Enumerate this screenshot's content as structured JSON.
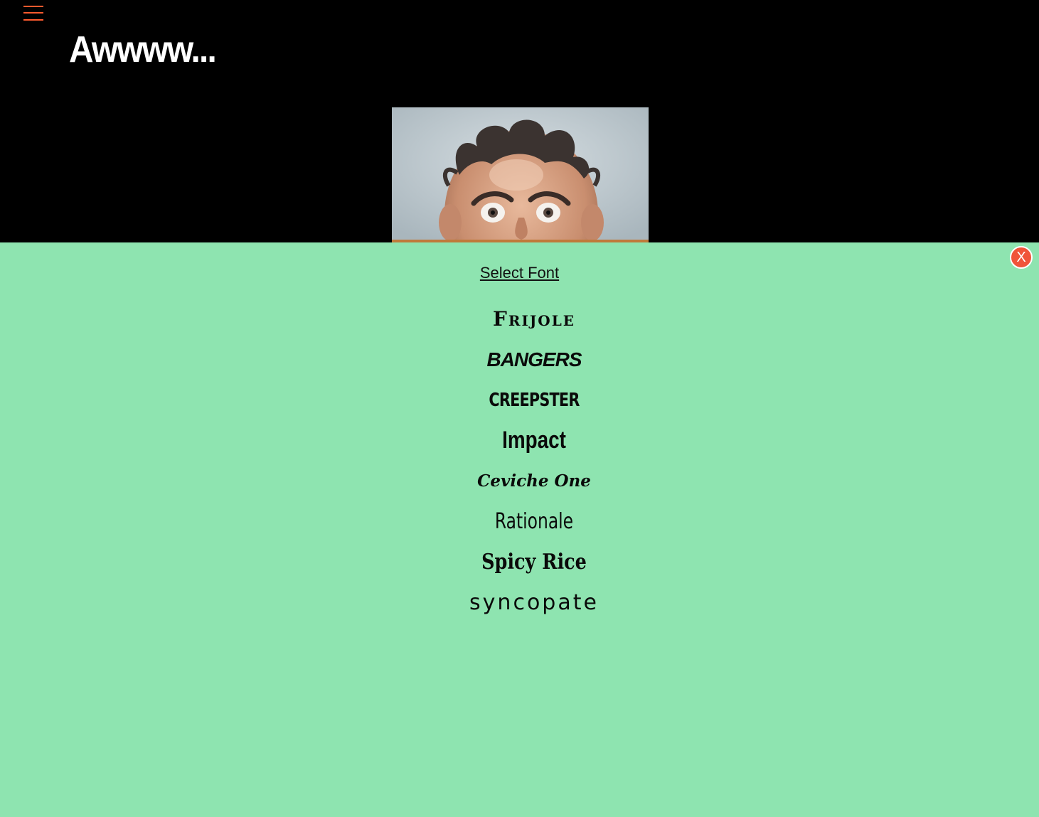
{
  "header": {
    "menu_icon": "hamburger-menu-icon",
    "accent_color": "#ff5a2e",
    "meme_title": "Awwww..."
  },
  "meme": {
    "image_subject": "bald-man-wide-eyes-photo"
  },
  "font_panel": {
    "title": "Select Font",
    "close_label": "X",
    "background_color": "#8ee4b0",
    "close_color": "#f0543a",
    "fonts": [
      {
        "label": "Frijole"
      },
      {
        "label": "Bangers"
      },
      {
        "label": "Creepster"
      },
      {
        "label": "Impact"
      },
      {
        "label": "Ceviche One"
      },
      {
        "label": "Rationale"
      },
      {
        "label": "Spicy Rice"
      },
      {
        "label": "Syncopate"
      }
    ]
  }
}
